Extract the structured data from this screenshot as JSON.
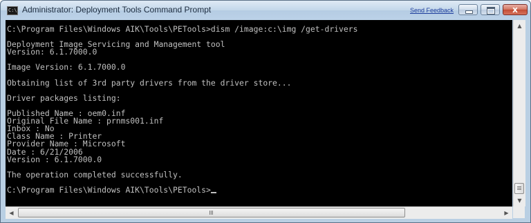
{
  "window": {
    "title": "Administrator: Deployment Tools Command Prompt",
    "send_feedback": "Send Feedback",
    "app_icon_label": "C:\\",
    "close_glyph": "x"
  },
  "console": {
    "lines": [
      "C:\\Program Files\\Windows AIK\\Tools\\PETools>dism /image:c:\\img /get-drivers",
      "",
      "Deployment Image Servicing and Management tool",
      "Version: 6.1.7000.0",
      "",
      "Image Version: 6.1.7000.0",
      "",
      "Obtaining list of 3rd party drivers from the driver store...",
      "",
      "Driver packages listing:",
      "",
      "Published Name : oem0.inf",
      "Original File Name : prnms001.inf",
      "Inbox : No",
      "Class Name : Printer",
      "Provider Name : Microsoft",
      "Date : 6/21/2006",
      "Version : 6.1.7000.0",
      "",
      "The operation completed successfully.",
      "",
      "C:\\Program Files\\Windows AIK\\Tools\\PETools>"
    ]
  },
  "scrollbars": {
    "vertical_position": 0.95,
    "horizontal_position": 0.0
  },
  "colors": {
    "console_bg": "#000000",
    "console_text": "#c0c0c0",
    "titlebar": "#c3d7ea",
    "close_button": "#c24b34"
  },
  "icons": [
    "console-app-icon",
    "minimize-icon",
    "maximize-icon",
    "close-icon",
    "scroll-up-icon",
    "scroll-down-icon",
    "scroll-left-icon",
    "scroll-right-icon"
  ]
}
